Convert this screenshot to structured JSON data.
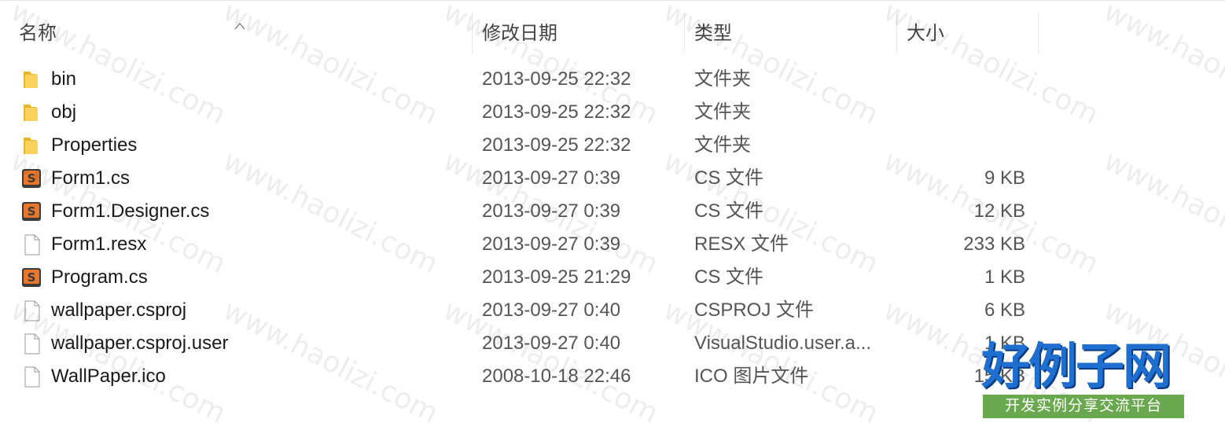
{
  "columns": {
    "name": "名称",
    "date": "修改日期",
    "type": "类型",
    "size": "大小"
  },
  "files": [
    {
      "icon": "folder-icon",
      "name": "bin",
      "date": "2013-09-25 22:32",
      "type": "文件夹",
      "size": ""
    },
    {
      "icon": "folder-icon",
      "name": "obj",
      "date": "2013-09-25 22:32",
      "type": "文件夹",
      "size": ""
    },
    {
      "icon": "folder-icon",
      "name": "Properties",
      "date": "2013-09-25 22:32",
      "type": "文件夹",
      "size": ""
    },
    {
      "icon": "csharp-file-icon",
      "name": "Form1.cs",
      "date": "2013-09-27 0:39",
      "type": "CS 文件",
      "size": "9 KB"
    },
    {
      "icon": "csharp-file-icon",
      "name": "Form1.Designer.cs",
      "date": "2013-09-27 0:39",
      "type": "CS 文件",
      "size": "12 KB"
    },
    {
      "icon": "file-icon",
      "name": "Form1.resx",
      "date": "2013-09-27 0:39",
      "type": "RESX 文件",
      "size": "233 KB"
    },
    {
      "icon": "csharp-file-icon",
      "name": "Program.cs",
      "date": "2013-09-25 21:29",
      "type": "CS 文件",
      "size": "1 KB"
    },
    {
      "icon": "file-icon",
      "name": "wallpaper.csproj",
      "date": "2013-09-27 0:40",
      "type": "CSPROJ 文件",
      "size": "6 KB"
    },
    {
      "icon": "file-icon",
      "name": "wallpaper.csproj.user",
      "date": "2013-09-27 0:40",
      "type": "VisualStudio.user.a...",
      "size": "1 KB"
    },
    {
      "icon": "file-icon",
      "name": "WallPaper.ico",
      "date": "2008-10-18 22:46",
      "type": "ICO 图片文件",
      "size": "15 KB"
    }
  ],
  "watermark": {
    "text": "www.haolizi.com",
    "brand_name": "好例子网",
    "brand_tagline": "开发实例分享交流平台"
  },
  "colors": {
    "folder": "#f4c542",
    "csharp_badge": "#e8762b",
    "brand_blue": "#1f6fd1",
    "brand_green": "#6aa84f"
  }
}
